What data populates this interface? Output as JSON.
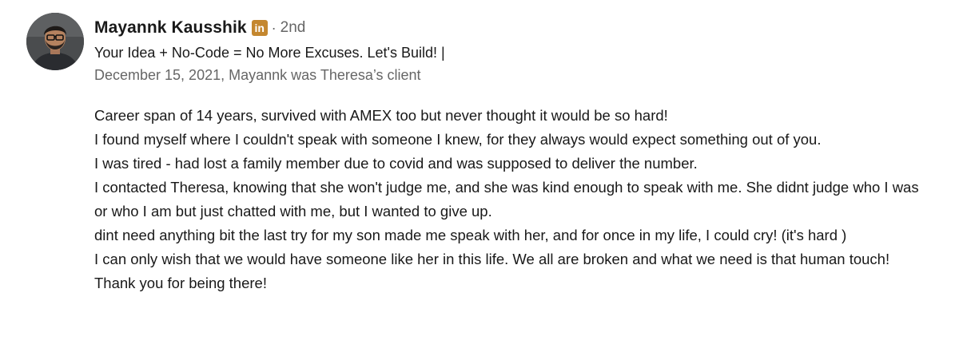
{
  "recommendation": {
    "author": {
      "name": "Mayannk Kausshik",
      "badge_icon": "linkedin-premium-icon",
      "badge_text": "in",
      "badge_color": "#c4872f",
      "separator": "·",
      "connection_degree": "2nd",
      "headline": "Your Idea + No-Code = No More Excuses. Let's Build! |",
      "avatar": "profile-photo"
    },
    "meta": "December 15, 2021, Mayannk was Theresa’s client",
    "body_lines": [
      "Career span of 14 years, survived with AMEX too but never thought it would be so hard!",
      "I found myself where I couldn't speak with someone I knew, for they always would expect something out of you.",
      "I was tired - had lost a family member due to covid and was supposed to deliver the number.",
      "I contacted Theresa, knowing that she won't judge me, and she was kind enough to speak with me. She didnt judge who I was or who I am but just chatted with me, but I wanted to give up.",
      "dint need anything bit the last try for my son made me speak with her, and for once in my life, I could cry! (it's hard )",
      "I can only wish that we would have someone like her in this life. We all are broken and what we need is that human touch! Thank you for being there!"
    ]
  }
}
